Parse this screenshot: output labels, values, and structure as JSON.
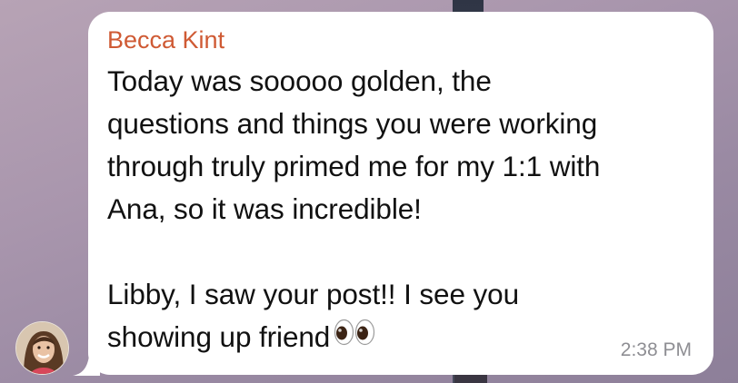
{
  "message": {
    "sender": "Becca Kint",
    "text": "Today was sooooo golden, the\nquestions and things you were working\nthrough truly primed me for my 1:1 with\nAna, so it was incredible!\n\nLibby, I saw your post!! I see you\nshowing up friend",
    "trailing_emoji": "eyes-emoji",
    "time": "2:38 PM"
  },
  "colors": {
    "sender_name": "#cf5a34",
    "bubble": "#ffffff",
    "timestamp": "#8e8e93"
  }
}
